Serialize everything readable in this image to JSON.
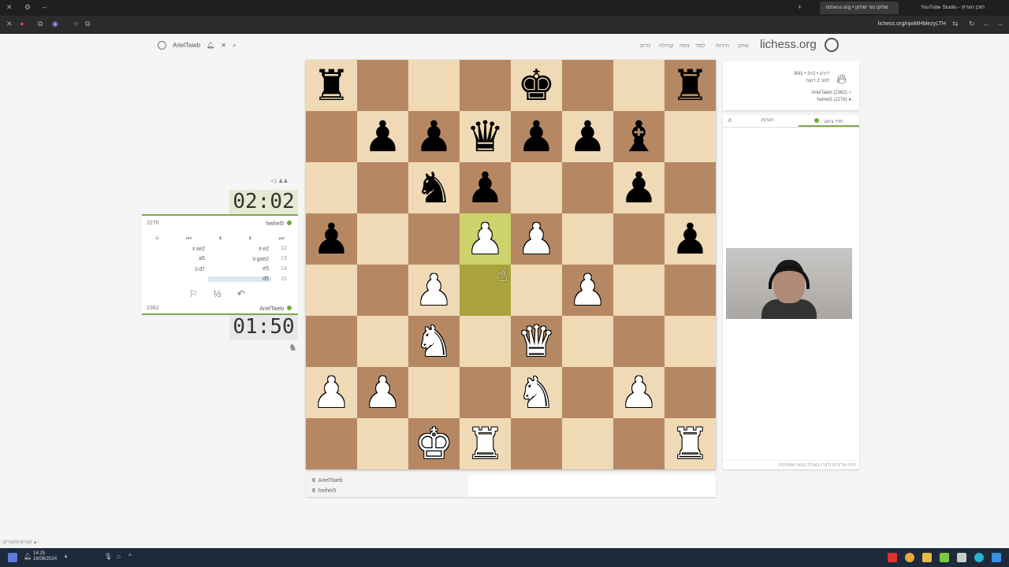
{
  "browser": {
    "tabs": [
      {
        "label": "lichess.org • שחקן נגד שחקן",
        "active": true
      },
      {
        "label": "YouTube Studio - תוכן הערוץ",
        "active": false
      }
    ],
    "url": "lichess.org/njwMHMezyLTH"
  },
  "site": {
    "logo": "lichess.org",
    "nav": [
      "שחק",
      "חידות",
      "למד",
      "צפה",
      "קהילה",
      "כלים"
    ],
    "username": "ArielTaieb"
  },
  "game": {
    "info_line1": "Blitz • דירוג • 3+2",
    "info_line2": "לפני 2 דקות",
    "player_white": "ArielTaieb (2362)",
    "player_black": "heihei5 (2276)"
  },
  "clock": {
    "top_time": "02:02",
    "bottom_time": "01:50",
    "top_badge": "+1"
  },
  "players": {
    "top": {
      "name": "heihei5",
      "rating": "2276"
    },
    "bottom": {
      "name": "ArielTaieb",
      "rating": "2362"
    }
  },
  "moves": [
    {
      "num": "12",
      "white": "♗e2",
      "black": "♗xe2"
    },
    {
      "num": "13",
      "white": "♕gxe2",
      "black": "a5"
    },
    {
      "num": "14",
      "white": "e5",
      "black": "♕d7"
    },
    {
      "num": "15",
      "white": "d5",
      "black": ""
    }
  ],
  "controls": {
    "menu": "≡",
    "first": "⏮",
    "prev": "⏴",
    "next": "⏵",
    "last": "⏭"
  },
  "actions": {
    "flag": "⚐",
    "draw": "½",
    "takeback": "↶"
  },
  "chat": {
    "tab_room": "חדר צ'אט",
    "tab_notes": "הערות",
    "footer": "היה אדיבים ודברו בצורה בוטה ואמיתית!"
  },
  "score": {
    "rows": [
      {
        "score": "0",
        "name": "ArielTaieb"
      },
      {
        "score": "0",
        "name": "heihei5"
      }
    ]
  },
  "taskbar": {
    "time": "14:25",
    "date": "16/08/2024",
    "status": "חברים מחוברים"
  },
  "board": {
    "light_color": "#f0d9b5",
    "dark_color": "#b58863",
    "rows": [
      [
        "br",
        "",
        "",
        "",
        "bk",
        "",
        "",
        "br"
      ],
      [
        "",
        "bp",
        "bp",
        "bq",
        "bp",
        "bp",
        "bb",
        ""
      ],
      [
        "",
        "",
        "bn",
        "bp",
        "",
        "",
        "bp",
        ""
      ],
      [
        "bp",
        "",
        "",
        "wp",
        "wp",
        "",
        "",
        "bp"
      ],
      [
        "",
        "",
        "wp",
        "",
        "",
        "wp",
        "",
        ""
      ],
      [
        "",
        "",
        "wn",
        "",
        "wq",
        "",
        "",
        ""
      ],
      [
        "wp",
        "wp",
        "",
        "",
        "wn",
        "",
        "wp",
        ""
      ],
      [
        "",
        "",
        "wk",
        "wr",
        "",
        "",
        "",
        "wr"
      ]
    ],
    "highlights": {
      "3,3": "hl",
      "4,3": "hl2"
    }
  }
}
